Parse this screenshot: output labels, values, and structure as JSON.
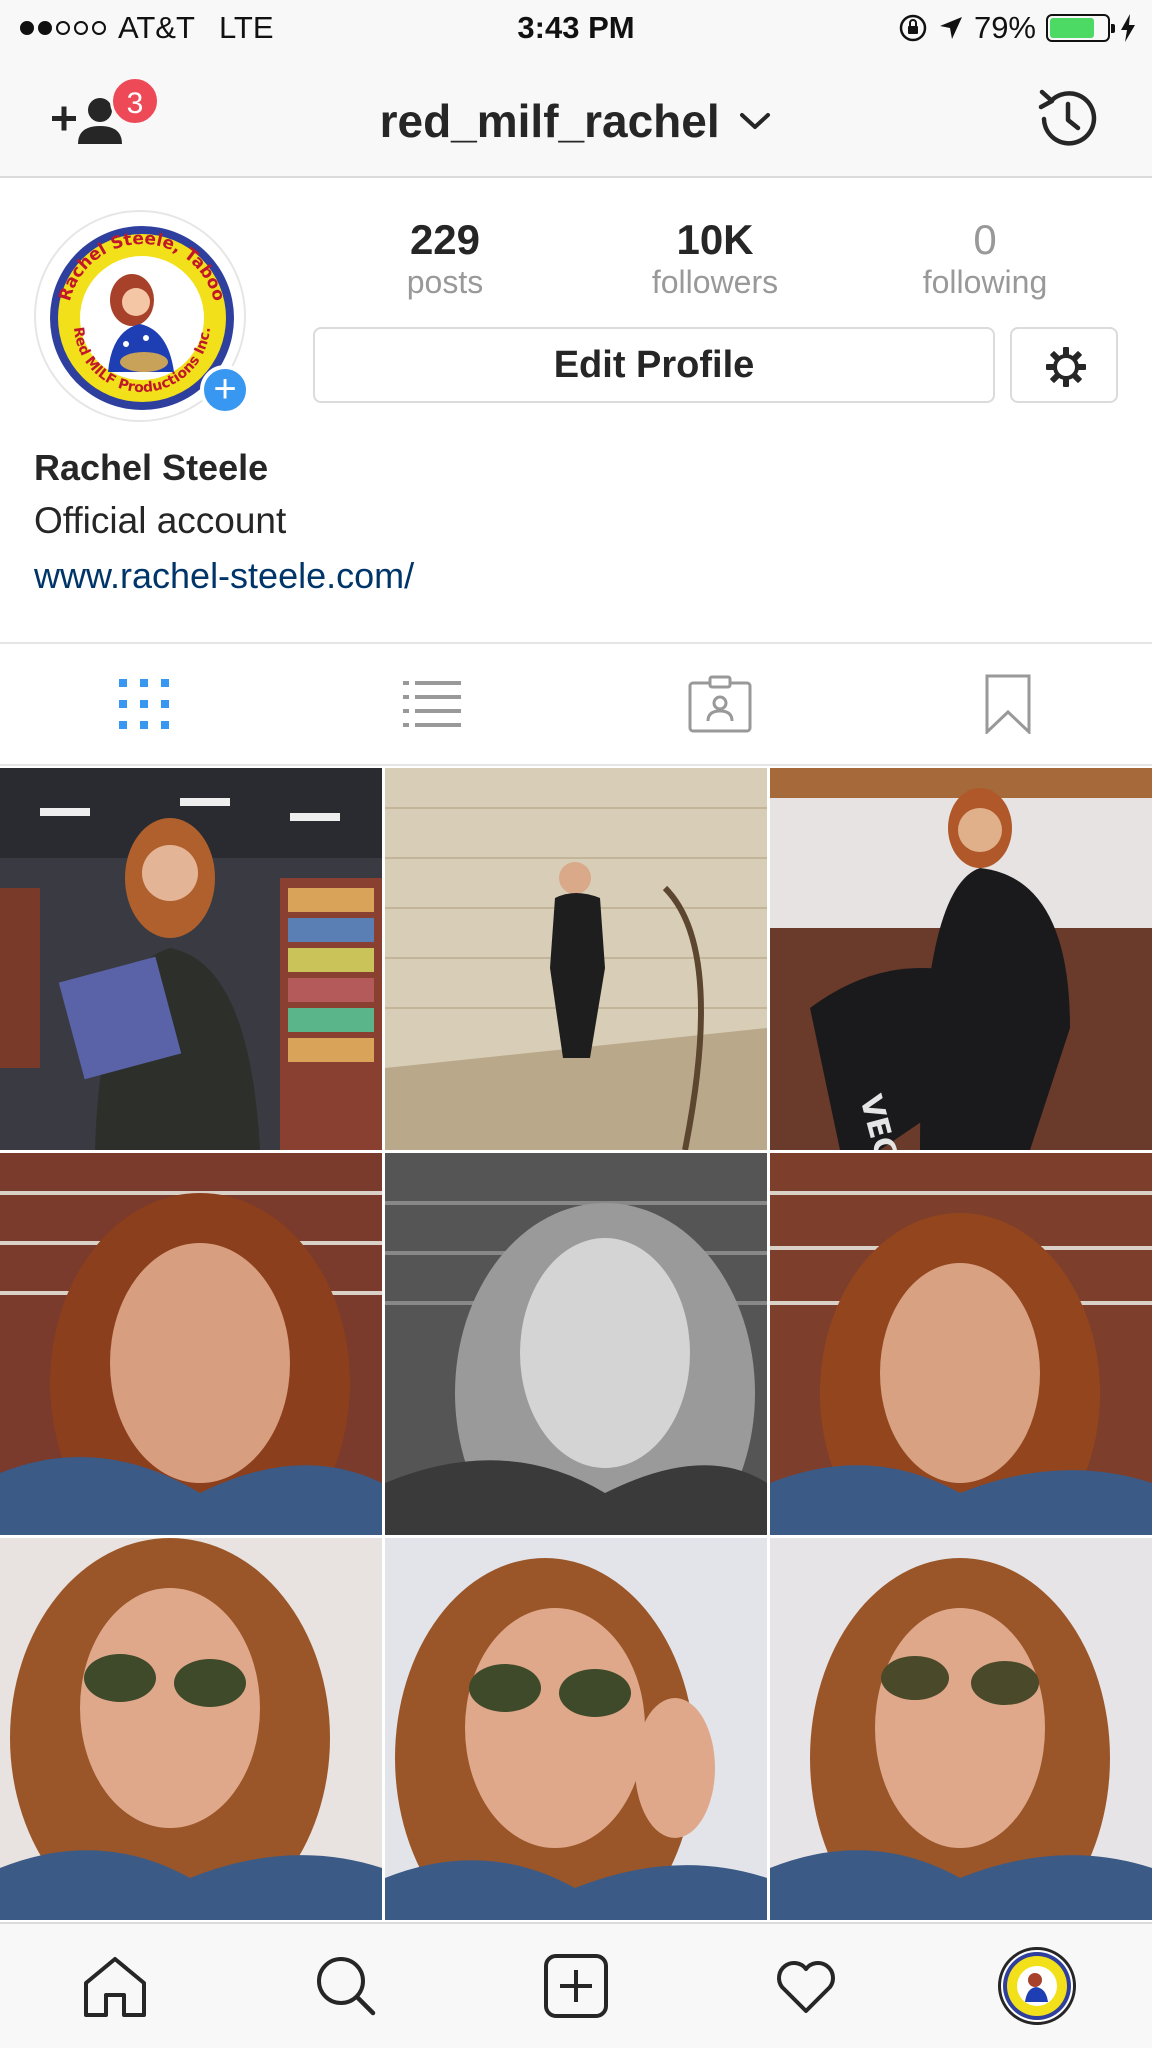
{
  "status_bar": {
    "carrier": "AT&T",
    "network": "LTE",
    "time": "3:43 PM",
    "battery_percent": "79%",
    "battery_level": 0.79,
    "signal_bars": 2,
    "icons": [
      "rotation-lock-icon",
      "location-arrow-icon",
      "charging-bolt-icon"
    ]
  },
  "nav": {
    "username": "red_milf_rachel",
    "notification_count": "3",
    "icons": [
      "add-user-icon",
      "chevron-down-icon",
      "history-icon"
    ]
  },
  "profile": {
    "avatar_logo_text_top": "Rachel Steele, Taboo",
    "avatar_logo_text_bottom": "Red MILF Productions Inc.",
    "stats": [
      {
        "count": "229",
        "label": "posts"
      },
      {
        "count": "10K",
        "label": "followers"
      },
      {
        "count": "0",
        "label": "following"
      }
    ],
    "edit_button": "Edit Profile",
    "name": "Rachel Steele",
    "bio": "Official account",
    "website": "www.rachel-steele.com/"
  },
  "view_tabs": [
    {
      "name": "grid-view",
      "icon": "grid-icon",
      "active": true
    },
    {
      "name": "list-view",
      "icon": "list-icon",
      "active": false
    },
    {
      "name": "tagged-view",
      "icon": "tagged-user-icon",
      "active": false
    },
    {
      "name": "saved-view",
      "icon": "bookmark-icon",
      "active": false
    }
  ],
  "grid_photo_overlay_text": [
    "VEGAN"
  ],
  "tab_bar": [
    {
      "name": "home",
      "icon": "home-icon"
    },
    {
      "name": "search",
      "icon": "search-icon"
    },
    {
      "name": "new-post",
      "icon": "add-post-icon"
    },
    {
      "name": "activity",
      "icon": "heart-icon"
    },
    {
      "name": "profile",
      "icon": "profile-avatar-icon"
    }
  ],
  "colors": {
    "accent_blue": "#3897f0",
    "badge_red": "#ed4956",
    "link_blue": "#003569",
    "text": "#262626",
    "muted": "#999999",
    "battery_green": "#4cd964"
  }
}
